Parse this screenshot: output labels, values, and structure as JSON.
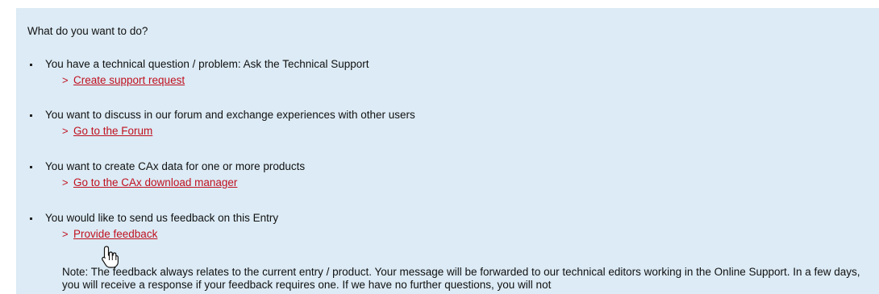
{
  "heading": "What do you want to do?",
  "options": [
    {
      "text": "You have a technical question / problem: Ask the Technical Support",
      "link": "Create support request"
    },
    {
      "text": "You want to discuss in our forum and exchange experiences with other users",
      "link": "Go to the Forum"
    },
    {
      "text": "You want to create CAx data for one or more products",
      "link": "Go to the CAx download manager"
    },
    {
      "text": "You would like to send us feedback on this Entry",
      "link": "Provide feedback"
    }
  ],
  "chevron": ">",
  "note": "Note: The feedback always relates to the current entry / product. Your message will be forwarded to our technical editors working in the Online Support. In a few days, you will receive a response if your feedback requires one. If we have no further questions, you will not",
  "icons": {
    "bullet": "square-bullet-icon",
    "link_arrow": "chevron-right-icon",
    "pointer": "hand-pointer-icon"
  },
  "colors": {
    "panel_background": "#dcebf5",
    "link": "#c0101f",
    "text": "#111111"
  }
}
